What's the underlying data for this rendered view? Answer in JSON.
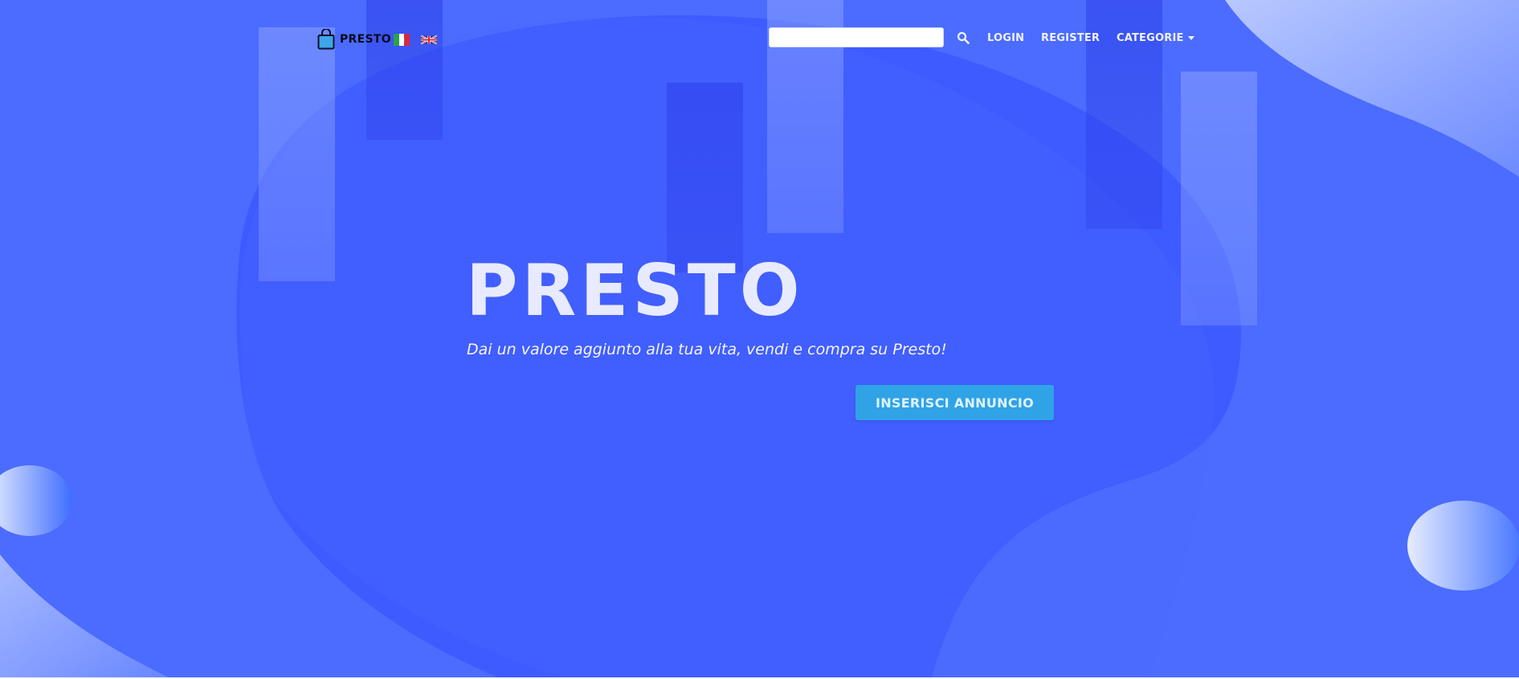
{
  "brand": {
    "name": "PRESTO",
    "icon": "shopping-bag-icon"
  },
  "languages": [
    {
      "code": "it",
      "icon": "flag-italy-icon"
    },
    {
      "code": "en",
      "icon": "flag-uk-icon"
    }
  ],
  "search": {
    "value": "",
    "placeholder": "",
    "icon": "search-icon"
  },
  "nav": {
    "login": "Login",
    "register": "Register",
    "categories": "Categorie"
  },
  "hero": {
    "title": "PRESTO",
    "subtitle": "Dai un valore aggiunto alla tua vita, vendi e compra su Presto!",
    "cta": "Inserisci annuncio"
  },
  "colors": {
    "background": "#4b6cff",
    "blob": "#3e5bff",
    "cta": "#2fa3e6",
    "text": "#e8ebff"
  }
}
